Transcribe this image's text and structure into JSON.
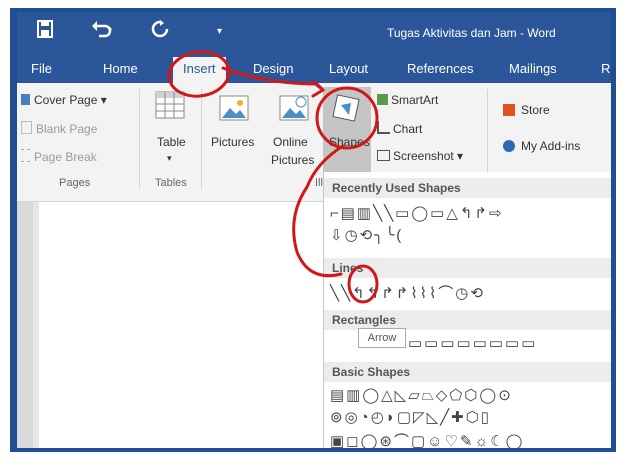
{
  "title_bar": {
    "document_title": "Tugas Aktivitas dan Jam - Word",
    "save_icon": "save-icon",
    "undo_icon": "undo-icon",
    "redo_icon": "redo-icon"
  },
  "tabs": [
    {
      "label": "File"
    },
    {
      "label": "Home"
    },
    {
      "label": "Insert"
    },
    {
      "label": "Design"
    },
    {
      "label": "Layout"
    },
    {
      "label": "References"
    },
    {
      "label": "Mailings"
    },
    {
      "label": "R"
    }
  ],
  "ribbon": {
    "pages": {
      "items": [
        "Cover Page ▾",
        "Blank Page",
        "Page Break"
      ],
      "group_label": "Pages"
    },
    "tables": {
      "button_label": "Table",
      "group_label": "Tables"
    },
    "illustrations": {
      "pictures_label": "Pictures",
      "online_pictures_label_1": "Online",
      "online_pictures_label_2": "Pictures",
      "shapes_label": "Shapes",
      "smartart_label": "SmartArt",
      "chart_label": "Chart",
      "screenshot_label": "Screenshot ▾"
    },
    "addins": {
      "store_label": "Store",
      "my_addins_label": "My Add-ins"
    }
  },
  "shapes_menu": {
    "recently_used_label": "Recently Used Shapes",
    "recently_row_1": "⌐▤▥╲╲▭◯▭△↰↱⇨",
    "recently_row_2": "⇩◷⟲╮╰(",
    "lines_label": "Lines",
    "lines_row": "╲╲↰↰↱↱⌇⌇⌇⌒◷⟲",
    "rectangles_label": "Rectangles",
    "rectangles_row": "▭▭▭▭▭▭▭▭",
    "basic_label": "Basic Shapes",
    "basic_row_1": "▤▥◯△◺▱⏢◇⬠⬡◯⊙",
    "basic_row_2": "⊚◎◔◴◗▢◸◺╱✚⬡▯",
    "basic_row_3": "▣◻◯⊛⌒▢☺♡✎☼☾◯",
    "tooltip": "Arrow"
  }
}
